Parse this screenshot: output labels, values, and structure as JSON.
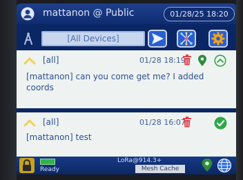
{
  "header": {
    "title": "mattanon @ Public",
    "datetime": "01/28/25 18:20"
  },
  "toolbar": {
    "device_filter": "[All Devices]",
    "send_icon": "send-arrow-icon",
    "mesh_icon": "mesh-network-icon",
    "settings_icon": "gear-icon"
  },
  "messages": [
    {
      "channel": "[all]",
      "time": "01/28 18:19",
      "text": "[mattanon] can you come get me? I added coords",
      "has_location": true,
      "status": "pending"
    },
    {
      "channel": "[all]",
      "time": "01/28 16:07",
      "text": "[mattanon] test",
      "has_location": false,
      "status": "delivered"
    }
  ],
  "status_bar": {
    "state": "Ready",
    "radio": "LoRa@914.3+",
    "mesh_cache": "Mesh Cache"
  },
  "colors": {
    "header_bg": "#1f3f8c",
    "accent_blue": "#2a5fd0",
    "settings_orange": "#f0a21a",
    "trash_red": "#e0454f",
    "ok_green": "#2ea84a"
  }
}
